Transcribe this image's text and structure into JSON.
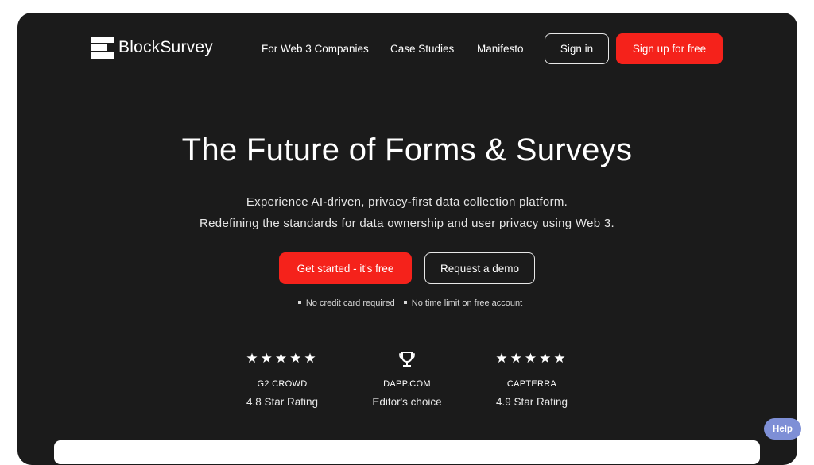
{
  "brand": {
    "name": "BlockSurvey"
  },
  "nav": {
    "items": [
      "For Web 3 Companies",
      "Case Studies",
      "Manifesto"
    ],
    "sign_in": "Sign in",
    "sign_up": "Sign up for free"
  },
  "hero": {
    "title": "The Future of Forms & Surveys",
    "subtitle_line1": "Experience AI-driven, privacy-first data collection platform.",
    "subtitle_line2": "Redefining the standards for data ownership and user privacy using Web 3.",
    "cta_primary": "Get started - it's free",
    "cta_secondary": "Request a demo",
    "notes": [
      "No credit card required",
      "No time limit on free account"
    ]
  },
  "ratings": [
    {
      "icon": "stars-icon",
      "source": "G2 CROWD",
      "label": "4.8 Star Rating"
    },
    {
      "icon": "trophy-icon",
      "source": "DAPP.COM",
      "label": "Editor's choice"
    },
    {
      "icon": "stars-icon",
      "source": "CAPTERRA",
      "label": "4.9 Star Rating"
    }
  ],
  "help": {
    "label": "Help"
  },
  "colors": {
    "background": "#1b1b1b",
    "accent": "#f5221b",
    "help": "#7e8fd6"
  }
}
